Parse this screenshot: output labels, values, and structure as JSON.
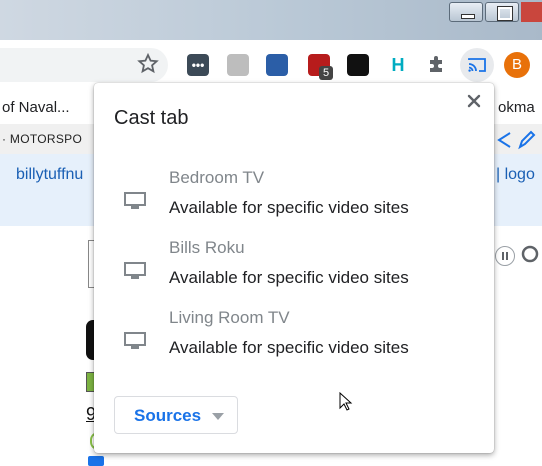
{
  "window_controls": {
    "minimize_icon": "minimize-icon",
    "restore_icon": "restore-icon"
  },
  "toolbar": {
    "extensions": [
      {
        "name": "password-manager-extension-icon",
        "color": "#3c4a57",
        "text": "•••"
      },
      {
        "name": "reader-extension-icon",
        "color": "#bdbdbd",
        "text": ""
      },
      {
        "name": "download-extension-icon",
        "color": "#2b5ea7",
        "text": ""
      },
      {
        "name": "ublock-extension-icon",
        "color": "#b71c1c",
        "text": ""
      },
      {
        "name": "lock-extension-icon",
        "color": "#111111",
        "text": ""
      },
      {
        "name": "h-extension-icon",
        "color": "#ffffff",
        "text": "H"
      }
    ],
    "ublock_badge": "5",
    "profile_initial": "B",
    "profile_color": "#e8710a"
  },
  "bookmarks": {
    "left_text": "of Naval...",
    "right_text": "okma"
  },
  "background_page": {
    "strip_text": "· MOTORSPO",
    "blue_link": "billytuffnu",
    "blue_right": "|  logo",
    "underline_char": "9"
  },
  "cast_popup": {
    "title": "Cast tab",
    "close_icon": "close-icon",
    "sinks": [
      {
        "name": "Bedroom TV",
        "status": "Available for specific video sites"
      },
      {
        "name": "Bills Roku",
        "status": "Available for specific video sites"
      },
      {
        "name": "Living Room TV",
        "status": "Available for specific video sites"
      }
    ],
    "sources_label": "Sources",
    "accent": "#1a73e8"
  }
}
